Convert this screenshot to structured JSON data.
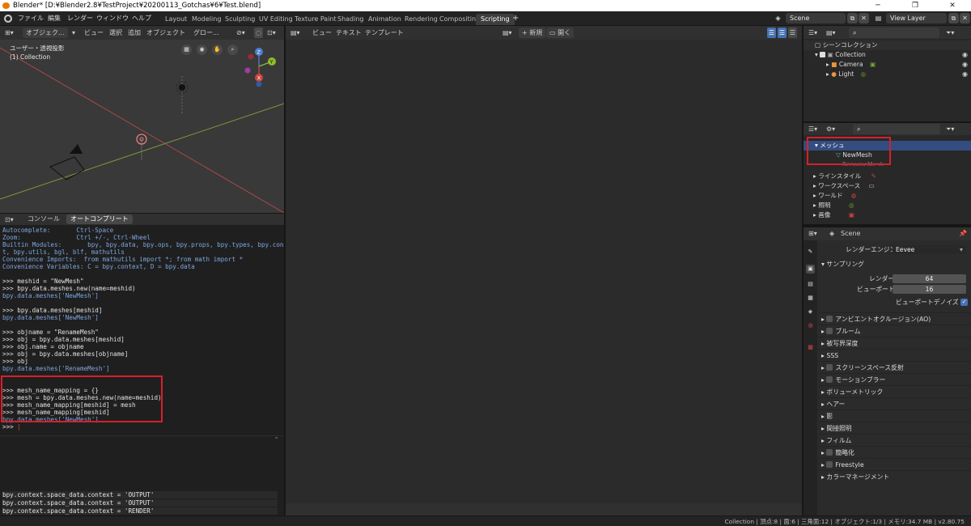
{
  "window": {
    "title": "Blender* [D:¥Blender2.8¥TestProject¥20200113_Gotchas¥6¥Test.blend]",
    "minimize": "─",
    "maximize": "❐",
    "close": "✕"
  },
  "menu": [
    "ファイル",
    "編集",
    "レンダー",
    "ウィンドウ",
    "ヘルプ"
  ],
  "workspaces": [
    "Layout",
    "Modeling",
    "Sculpting",
    "UV Editing",
    "Texture Paint",
    "Shading",
    "Animation",
    "Rendering",
    "Compositing",
    "Scripting"
  ],
  "active_workspace": "Scripting",
  "add_workspace": "+",
  "scene": {
    "label": "Scene",
    "view_layer": "View Layer"
  },
  "viewport": {
    "mode": "オブジェク...",
    "view": "ビュー",
    "select": "選択",
    "add": "追加",
    "object": "オブジェクト",
    "transform": "グロー...",
    "perspective_label": "ユーザー・透視投影",
    "collection_label": "(1) Collection",
    "gizmo": {
      "z": "Z",
      "y": "Y",
      "x": "X"
    }
  },
  "text_editor": {
    "view": "ビュー",
    "text": "テキスト",
    "template": "テンプレート",
    "new": "新規",
    "open": "開く"
  },
  "console": {
    "tabs": [
      "コンソール",
      "オートコンプリート"
    ],
    "lines": [
      {
        "text": "Autocomplete:       Ctrl-Space",
        "color": "blue"
      },
      {
        "text": "Zoom:               Ctrl +/-, Ctrl-Wheel",
        "color": "blue"
      },
      {
        "text": "Builtin Modules:       bpy, bpy.data, bpy.ops, bpy.props, bpy.types, bpy.contex",
        "color": "blue"
      },
      {
        "text": "t, bpy.utils, bgl, blf, mathutils",
        "color": "blue"
      },
      {
        "text": "Convenience Imports:  from mathutils import *; from math import *",
        "color": "blue"
      },
      {
        "text": "Convenience Variables: C = bpy.context, D = bpy.data",
        "color": "blue"
      },
      {
        "text": "",
        "color": "white"
      },
      {
        "text": ">>> meshid = \"NewMesh\"",
        "color": "white"
      },
      {
        "text": ">>> bpy.data.meshes.new(name=meshid)",
        "color": "white"
      },
      {
        "text": "bpy.data.meshes['NewMesh']",
        "color": "blue"
      },
      {
        "text": "",
        "color": "white"
      },
      {
        "text": ">>> bpy.data.meshes[meshid]",
        "color": "white"
      },
      {
        "text": "bpy.data.meshes['NewMesh']",
        "color": "blue"
      },
      {
        "text": "",
        "color": "white"
      },
      {
        "text": ">>> objname = \"RenameMesh\"",
        "color": "white"
      },
      {
        "text": ">>> obj = bpy.data.meshes[meshid]",
        "color": "white"
      },
      {
        "text": ">>> obj.name = objname",
        "color": "white"
      },
      {
        "text": ">>> obj = bpy.data.meshes[objname]",
        "color": "white"
      },
      {
        "text": ">>> obj",
        "color": "white"
      },
      {
        "text": "bpy.data.meshes['RenameMesh']",
        "color": "blue"
      },
      {
        "text": "",
        "color": "white"
      },
      {
        "text": "",
        "color": "white"
      },
      {
        "text": ">>> mesh_name_mapping = {}",
        "color": "white"
      },
      {
        "text": ">>> mesh = bpy.data.meshes.new(name=meshid)",
        "color": "white"
      },
      {
        "text": ">>> mesh_name_mapping[meshid] = mesh",
        "color": "white"
      },
      {
        "text": ">>> mesh_name_mapping[meshid]",
        "color": "white"
      },
      {
        "text": "bpy.data.meshes['NewMesh']",
        "color": "blue"
      }
    ],
    "prompt": ">>> "
  },
  "info": [
    "bpy.context.space_data.context = 'OUTPUT'",
    "bpy.context.space_data.context = 'OUTPUT'",
    "bpy.context.space_data.context = 'RENDER'"
  ],
  "outliner": {
    "root": "シーンコレクション",
    "collection": "Collection",
    "camera": "Camera",
    "light": "Light"
  },
  "data_api": {
    "mesh_group": "メッシュ",
    "mesh_item": "NewMesh",
    "renamed_item": "RenameMesh",
    "items": [
      "ラインスタイル",
      "ワークスペース",
      "ワールド",
      "照明",
      "画像"
    ]
  },
  "properties": {
    "scene": "Scene",
    "render_engine_label": "レンダーエンジン",
    "render_engine": "Eevee",
    "sampling": "サンプリング",
    "render_label": "レンダー",
    "render_samples": "64",
    "viewport_label": "ビューポート",
    "viewport_samples": "16",
    "viewport_denoise": "ビューポートデノイズ",
    "panels": [
      {
        "label": "アンビエントオクルージョン(AO)",
        "check": true
      },
      {
        "label": "ブルーム",
        "check": true
      },
      {
        "label": "被写界深度",
        "check": false
      },
      {
        "label": "SSS",
        "check": false
      },
      {
        "label": "スクリーンスペース反射",
        "check": true
      },
      {
        "label": "モーションブラー",
        "check": true
      },
      {
        "label": "ボリューメトリック",
        "check": false
      },
      {
        "label": "ヘアー",
        "check": false
      },
      {
        "label": "影",
        "check": false
      },
      {
        "label": "間接照明",
        "check": false
      },
      {
        "label": "フィルム",
        "check": false
      },
      {
        "label": "簡略化",
        "check": true
      },
      {
        "label": "Freestyle",
        "check": true
      },
      {
        "label": "カラーマネージメント",
        "check": false
      }
    ]
  },
  "status": "Collection | 頂点:8 | 面:6 | 三角面:12 | オブジェクト:1/3 | メモリ:34.7 MB | v2.80.75"
}
